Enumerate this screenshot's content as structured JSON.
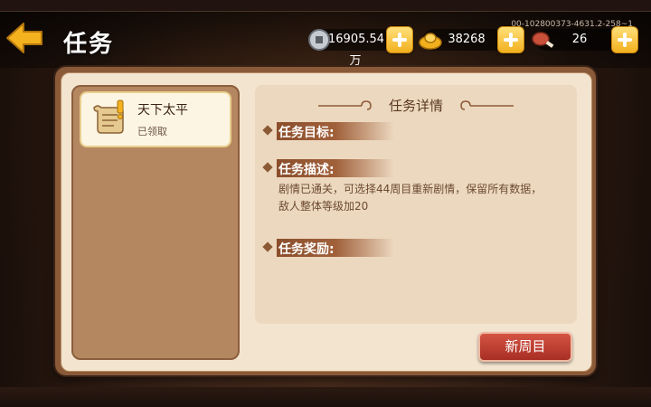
{
  "header": {
    "title": "任务",
    "version": "00-102800373-4631.2-258~1"
  },
  "resources": [
    {
      "name": "silver-coin",
      "value": "16905.54万"
    },
    {
      "name": "gold-ingot",
      "value": "38268"
    },
    {
      "name": "meat-stamina",
      "value": "26"
    }
  ],
  "tasks": [
    {
      "name": "天下太平",
      "status": "已领取"
    }
  ],
  "detail": {
    "title": "任务详情",
    "goal_label": "任务目标:",
    "desc_label": "任务描述:",
    "description": "剧情已通关，可选择44周目重新剧情，保留所有数据，敌人整体等级加20",
    "reward_label": "任务奖励:"
  },
  "actions": {
    "new_cycle": "新周目"
  },
  "colors": {
    "accent_gold": "#f2b01e",
    "button_red": "#c0392b",
    "panel_bg": "#f3e4cf"
  }
}
